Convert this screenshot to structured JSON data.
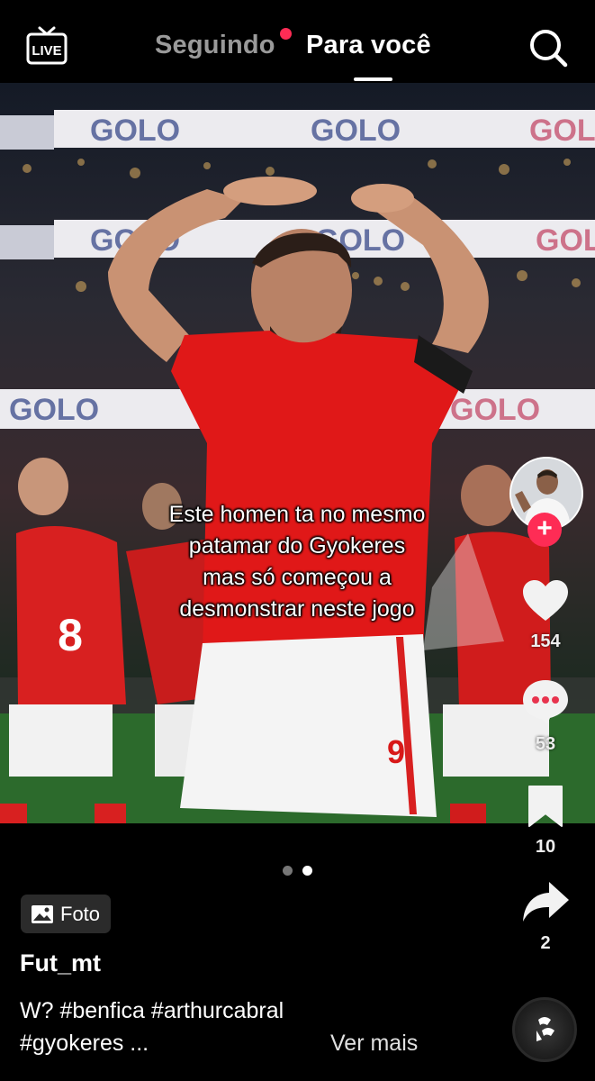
{
  "header": {
    "live_label": "LIVE",
    "tab_following": "Seguindo",
    "tab_for_you": "Para você",
    "notification_dot_color": "#fe2c55",
    "icons": {
      "live": "live-tv-icon",
      "search": "search-icon"
    }
  },
  "post": {
    "overlay_text_lines": [
      "Este homen ta no mesmo",
      "patamar do Gyokeres",
      "mas só começou a",
      "desmonstrar neste jogo"
    ],
    "banner_text": "GOLO",
    "jersey_number": "9",
    "carousel": {
      "total": 2,
      "current": 2
    }
  },
  "actions": {
    "likes": "154",
    "comments": "53",
    "saves": "10",
    "shares": "2",
    "follow_button_color": "#fe2c55",
    "icons": [
      "heart-icon",
      "comment-icon",
      "bookmark-icon",
      "share-icon",
      "plus-icon"
    ]
  },
  "info": {
    "badge_label": "Foto",
    "username": "Fut_mt",
    "caption_line1": "W? #benfica #arthurcabral",
    "caption_line2": "#gyokeres ...",
    "see_more": "Ver mais"
  }
}
